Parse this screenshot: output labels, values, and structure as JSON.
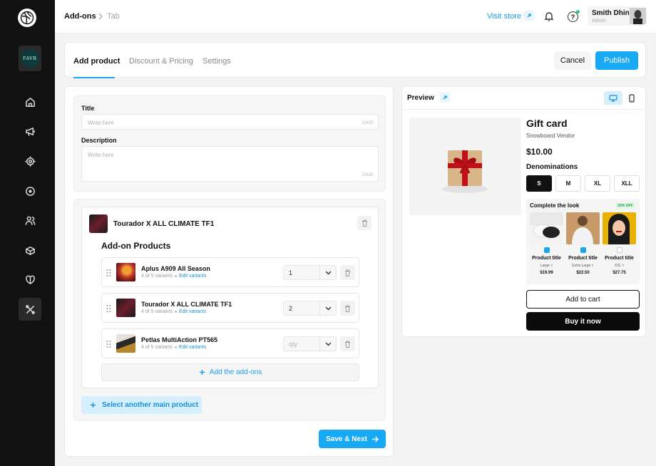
{
  "sidebar": {
    "store_logo_text": "FAVR",
    "nav_icons": [
      "home-icon",
      "megaphone-icon",
      "target-icon",
      "circle-dot-icon",
      "users-icon",
      "gift-box-icon",
      "tag-heart-icon",
      "tools-icon"
    ],
    "active_index": 7
  },
  "topbar": {
    "breadcrumb": [
      "Add-ons",
      "Tab"
    ],
    "visit_store": "Visit store",
    "user_name": "Smith Dhin",
    "user_role": "Admin",
    "help_label": "?"
  },
  "tabs": {
    "items": [
      "Add product",
      "Discount & Pricing",
      "Settings"
    ],
    "active": "Add product",
    "cancel": "Cancel",
    "publish": "Publish"
  },
  "form": {
    "title_label": "Title",
    "title_placeholder": "Write here",
    "title_count": "10/20",
    "desc_label": "Description",
    "desc_placeholder": "Write here",
    "desc_count": "10/20",
    "main_product": "Tourador X ALL CLIMATE TF1",
    "addon_heading": "Add-on Products",
    "addons": [
      {
        "title": "Aplus A909 All Season",
        "variants": "4 of 5 variants",
        "edit": "Edit variants",
        "qty": "1"
      },
      {
        "title": "Tourador X ALL CLIMATE TF1",
        "variants": "4 of 5 variants",
        "edit": "Edit variants",
        "qty": "2"
      },
      {
        "title": "Petlas MultiAction PT565",
        "variants": "4 of 5 variants",
        "edit": "Edit variants",
        "qty_placeholder": "qty"
      }
    ],
    "add_addons": "Add the add-ons",
    "select_main": "Select another main product",
    "save_next": "Save & Next"
  },
  "preview": {
    "title": "Preview",
    "product_name": "Gift card",
    "vendor": "Snowboard Vendor",
    "price": "$10.00",
    "denominations_label": "Denominations",
    "sizes": [
      "S",
      "M",
      "XL",
      "XLL"
    ],
    "active_size": "S",
    "look_title": "Complete the look",
    "look_badge": "20% OFF",
    "look_products": [
      {
        "title": "Product title",
        "size": "Large",
        "price": "$19.99",
        "checked": true
      },
      {
        "title": "Product title",
        "size": "Extra Large",
        "price": "$22.50",
        "checked": true
      },
      {
        "title": "Product title",
        "size": "XXL",
        "price": "$27.75",
        "checked": false
      }
    ],
    "add_to_cart": "Add to cart",
    "buy_now": "Buy it now"
  },
  "colors": {
    "accent": "#18a9f5",
    "sidebar_bg": "#111111",
    "link": "#1a8fd8"
  }
}
